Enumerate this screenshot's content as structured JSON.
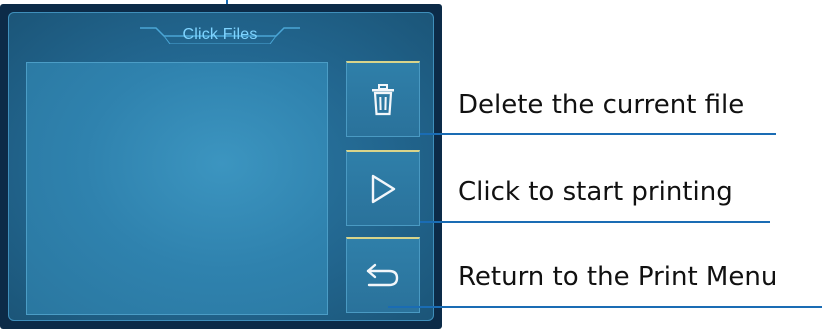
{
  "screen": {
    "header_title": "Click Files",
    "buttons": {
      "delete": {
        "icon": "trash-icon"
      },
      "print": {
        "icon": "play-icon"
      },
      "back": {
        "icon": "return-arrow-icon"
      }
    }
  },
  "callouts": {
    "delete": "Delete the current file",
    "print": "Click to start printing",
    "back": "Return to the Print Menu"
  },
  "colors": {
    "callout_line": "#1a6cb4",
    "title_text": "#7fd4ff",
    "screen_bezel": "#0c2b48",
    "button_top_accent": "#d8d48a"
  }
}
